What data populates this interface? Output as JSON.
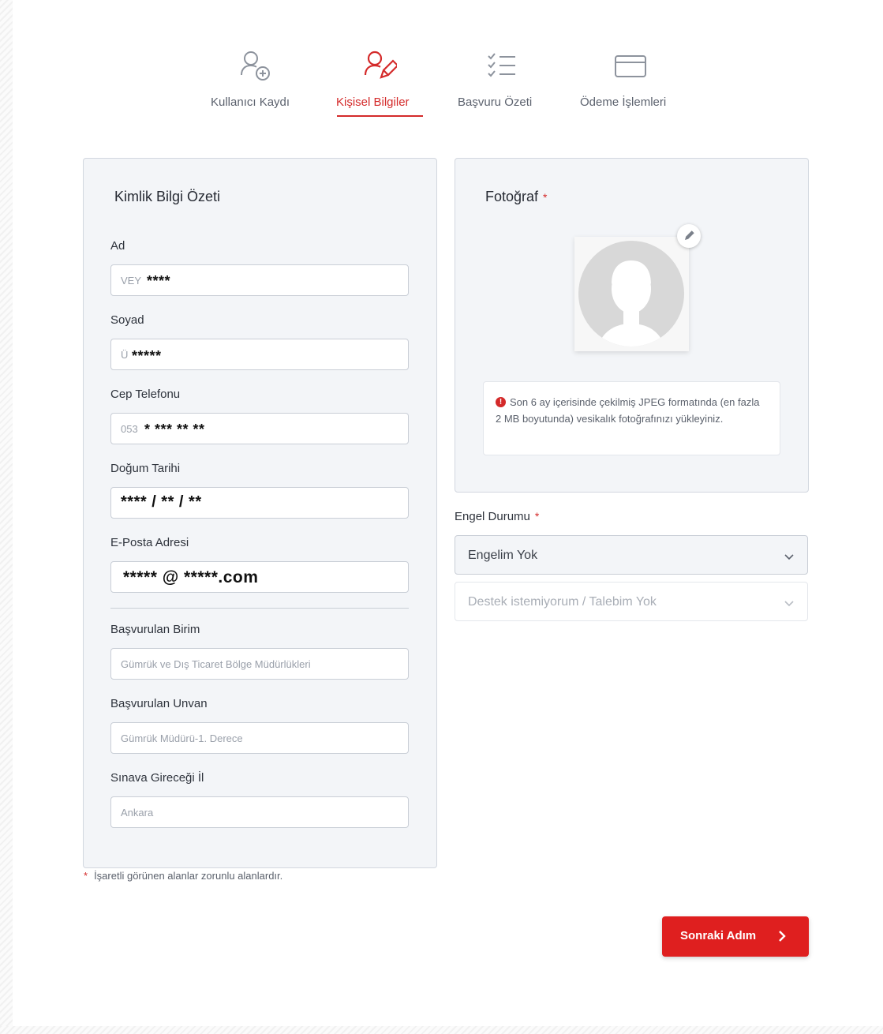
{
  "stepper": [
    {
      "label": "Kullanıcı Kaydı",
      "icon": "user-plus-icon",
      "active": false
    },
    {
      "label": "Kişisel Bilgiler",
      "icon": "user-edit-icon",
      "active": true
    },
    {
      "label": "Başvuru Özeti",
      "icon": "checklist-icon",
      "active": false
    },
    {
      "label": "Ödeme İşlemleri",
      "icon": "credit-card-icon",
      "active": false
    }
  ],
  "identity": {
    "title": "Kimlik Bilgi Özeti",
    "first_name": {
      "label": "Ad",
      "prefix": "VEY",
      "mask": "****"
    },
    "last_name": {
      "label": "Soyad",
      "prefix": "Ü",
      "mask": "*****"
    },
    "phone": {
      "label": "Cep Telefonu",
      "prefix": "053",
      "mask": "* *** ** **"
    },
    "birth_date": {
      "label": "Doğum Tarihi",
      "mask": "**** / ** / **"
    },
    "email": {
      "label": "E-Posta Adresi",
      "mask": "***** @ *****.com"
    },
    "unit": {
      "label": "Başvurulan Birim",
      "value": "Gümrük ve Dış Ticaret Bölge Müdürlükleri"
    },
    "title_applied": {
      "label": "Başvurulan Unvan",
      "value": "Gümrük Müdürü-1. Derece"
    },
    "exam_city": {
      "label": "Sınava Gireceği İl",
      "value": "Ankara"
    }
  },
  "photo": {
    "title": "Fotoğraf",
    "required_mark": "*",
    "info": "Son 6 ay içerisinde çekilmiş JPEG formatında (en fazla 2 MB boyutunda) vesikalık fotoğrafınızı yükleyiniz."
  },
  "disability": {
    "label": "Engel Durumu",
    "required_mark": "*",
    "status_value": "Engelim Yok",
    "support_value": "Destek istemiyorum / Talebim Yok"
  },
  "footnote": {
    "star": "*",
    "text": "İşaretli görünen alanlar zorunlu alanlardır."
  },
  "next_button": {
    "label": "Sonraki Adım"
  },
  "colors": {
    "accent": "#df1f1f",
    "active_step": "#d42a2a",
    "card_bg": "#f3f5f8"
  }
}
